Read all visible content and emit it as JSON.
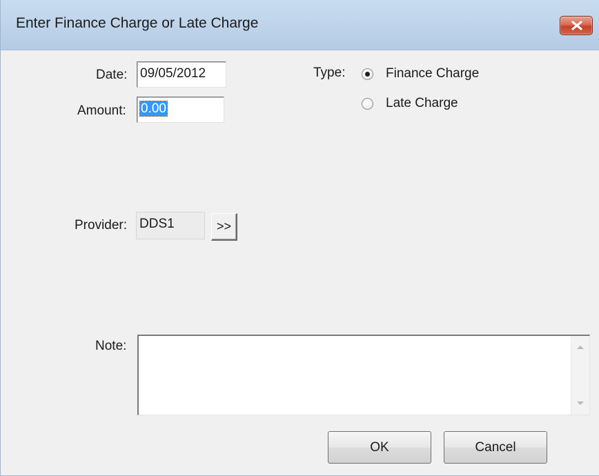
{
  "window": {
    "title": "Enter Finance Charge or Late Charge",
    "close_icon": "close-x-icon"
  },
  "form": {
    "date_label": "Date:",
    "date_value": "09/05/2012",
    "amount_label": "Amount:",
    "amount_value": "0.00",
    "type_label": "Type:",
    "type_options": [
      {
        "label": "Finance Charge",
        "selected": true
      },
      {
        "label": "Late Charge",
        "selected": false
      }
    ],
    "provider_label": "Provider:",
    "provider_value": "DDS1",
    "provider_pick_label": ">>",
    "note_label": "Note:",
    "note_value": ""
  },
  "buttons": {
    "ok_label": "OK",
    "cancel_label": "Cancel"
  },
  "colors": {
    "titlebar": "#bed3ea",
    "close_button": "#c54228",
    "selection": "#3399ff",
    "dialog_bg": "#f0f0f0"
  }
}
